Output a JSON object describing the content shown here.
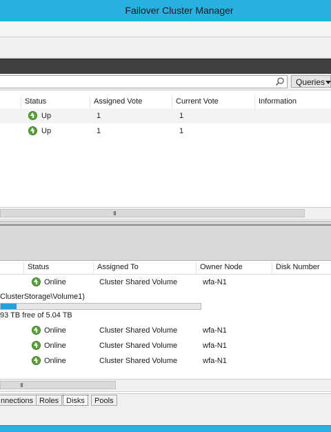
{
  "window": {
    "title": "Failover Cluster Manager"
  },
  "search": {
    "placeholder": "",
    "queries_label": "Queries"
  },
  "nodes_table": {
    "columns": [
      "Status",
      "Assigned Vote",
      "Current Vote",
      "Information"
    ],
    "rows": [
      {
        "status": "Up",
        "assigned_vote": "1",
        "current_vote": "1"
      },
      {
        "status": "Up",
        "assigned_vote": "1",
        "current_vote": "1"
      }
    ]
  },
  "disks_table": {
    "columns": [
      "Status",
      "Assigned To",
      "Owner Node",
      "Disk Number"
    ],
    "first_row": {
      "status": "Online",
      "assigned_to": "Cluster Shared Volume",
      "owner_node": "wfa-N1"
    },
    "volume": {
      "path": "ClusterStorage\\Volume1)",
      "free_text": "93 TB free of 5.04 TB",
      "used_fraction": 0.08
    },
    "rows": [
      {
        "status": "Online",
        "assigned_to": "Cluster Shared Volume",
        "owner_node": "wfa-N1"
      },
      {
        "status": "Online",
        "assigned_to": "Cluster Shared Volume",
        "owner_node": "wfa-N1"
      },
      {
        "status": "Online",
        "assigned_to": "Cluster Shared Volume",
        "owner_node": "wfa-N1"
      }
    ]
  },
  "tabs": [
    "nnections",
    "Roles",
    "Disks",
    "Pools"
  ],
  "active_tab": "Disks",
  "colors": {
    "accent": "#29b0e0",
    "status_up": "#5aa33c",
    "progress": "#26a0da"
  },
  "icons": {
    "status": "up-arrow-icon",
    "search": "search-icon",
    "dropdown": "chevron-down-icon",
    "scroll_grip": "grip-icon"
  }
}
